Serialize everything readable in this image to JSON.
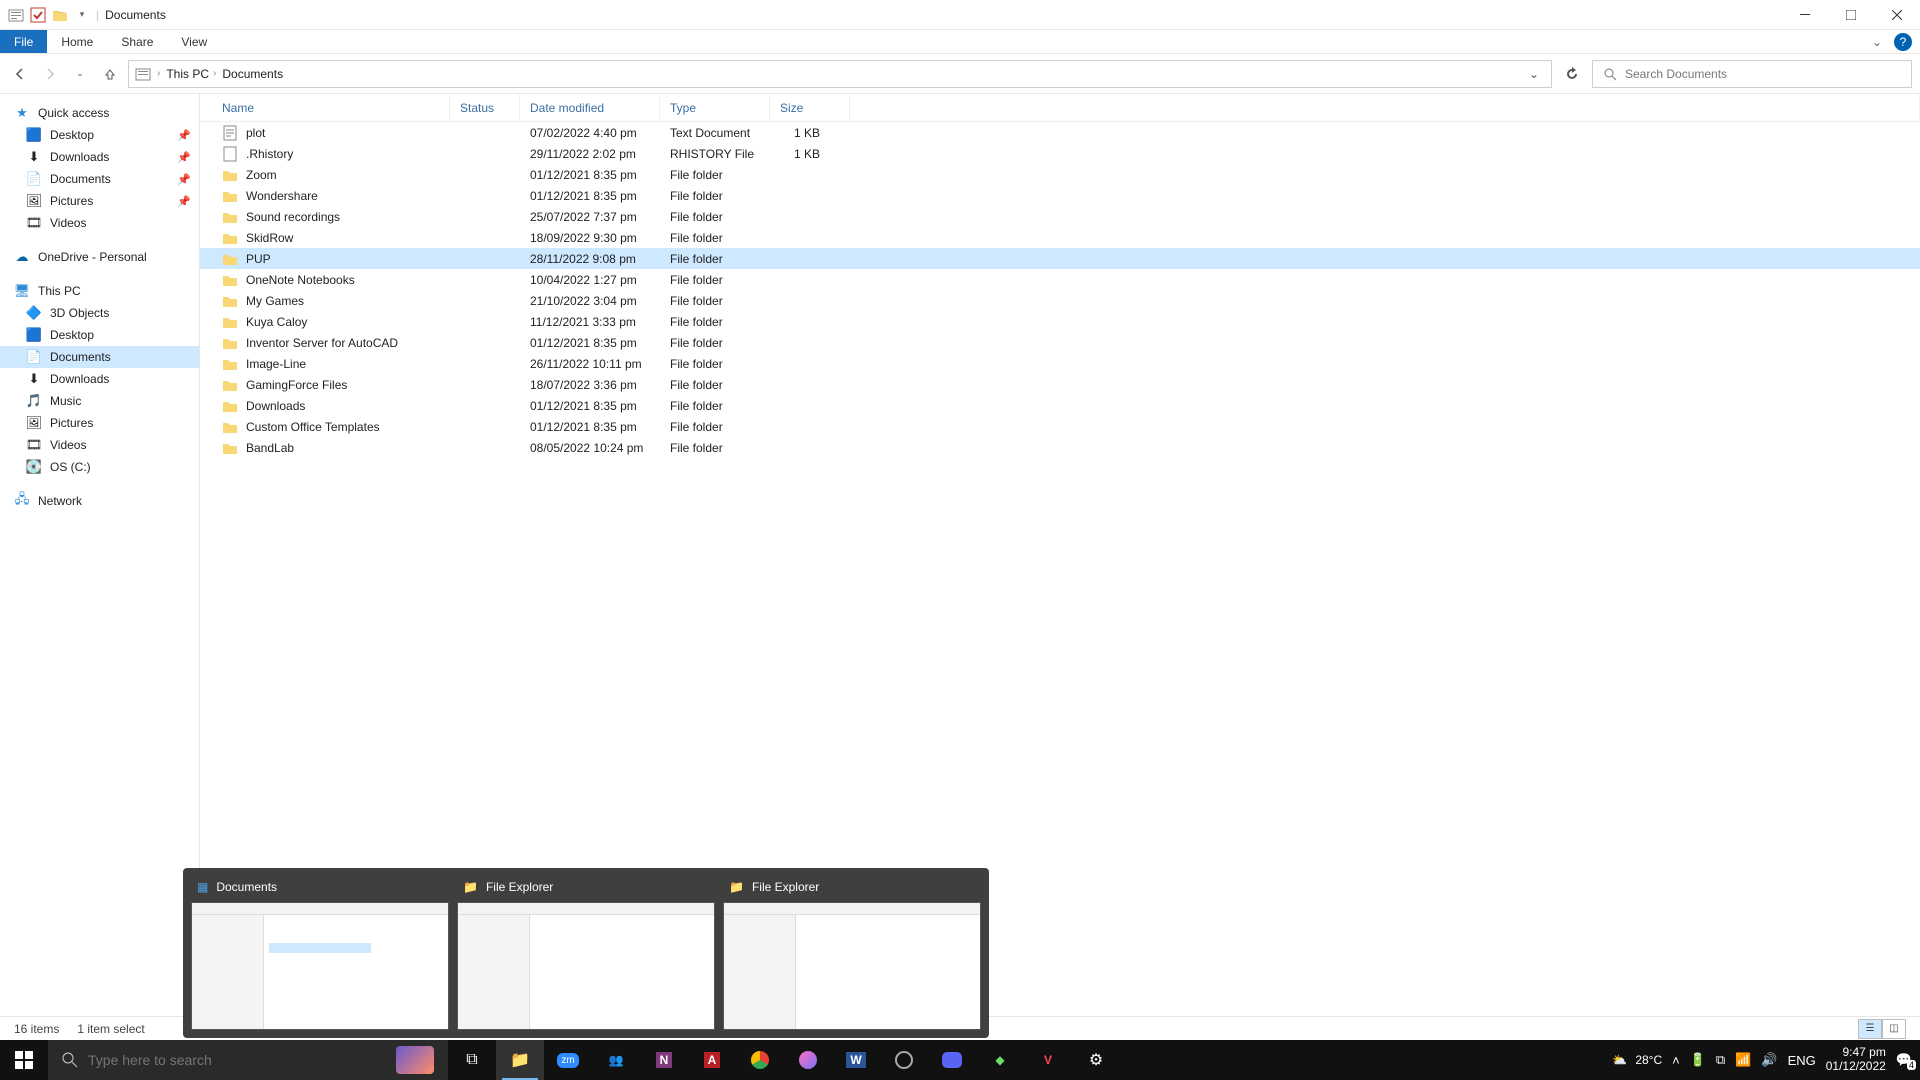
{
  "window": {
    "title": "Documents"
  },
  "ribbon": {
    "file": "File",
    "tabs": [
      "Home",
      "Share",
      "View"
    ]
  },
  "breadcrumb": {
    "root": "This PC",
    "current": "Documents"
  },
  "search": {
    "placeholder": "Search Documents"
  },
  "columns": {
    "name": "Name",
    "status": "Status",
    "date": "Date modified",
    "type": "Type",
    "size": "Size"
  },
  "sidebar": {
    "quick_access": "Quick access",
    "qa_items": [
      {
        "label": "Desktop",
        "pinned": true
      },
      {
        "label": "Downloads",
        "pinned": true
      },
      {
        "label": "Documents",
        "pinned": true
      },
      {
        "label": "Pictures",
        "pinned": true
      },
      {
        "label": "Videos",
        "pinned": false
      }
    ],
    "onedrive": "OneDrive - Personal",
    "this_pc": "This PC",
    "pc_items": [
      "3D Objects",
      "Desktop",
      "Documents",
      "Downloads",
      "Music",
      "Pictures",
      "Videos",
      "OS (C:)"
    ],
    "network": "Network"
  },
  "rows": [
    {
      "name": "plot",
      "date": "07/02/2022 4:40 pm",
      "type": "Text Document",
      "size": "1 KB",
      "icon": "text"
    },
    {
      "name": ".Rhistory",
      "date": "29/11/2022 2:02 pm",
      "type": "RHISTORY File",
      "size": "1 KB",
      "icon": "file"
    },
    {
      "name": "Zoom",
      "date": "01/12/2021 8:35 pm",
      "type": "File folder",
      "size": "",
      "icon": "folder"
    },
    {
      "name": "Wondershare",
      "date": "01/12/2021 8:35 pm",
      "type": "File folder",
      "size": "",
      "icon": "folder"
    },
    {
      "name": "Sound recordings",
      "date": "25/07/2022 7:37 pm",
      "type": "File folder",
      "size": "",
      "icon": "folder"
    },
    {
      "name": "SkidRow",
      "date": "18/09/2022 9:30 pm",
      "type": "File folder",
      "size": "",
      "icon": "folder"
    },
    {
      "name": "PUP",
      "date": "28/11/2022 9:08 pm",
      "type": "File folder",
      "size": "",
      "icon": "folder",
      "selected": true
    },
    {
      "name": "OneNote Notebooks",
      "date": "10/04/2022 1:27 pm",
      "type": "File folder",
      "size": "",
      "icon": "folder"
    },
    {
      "name": "My Games",
      "date": "21/10/2022 3:04 pm",
      "type": "File folder",
      "size": "",
      "icon": "folder"
    },
    {
      "name": "Kuya Caloy",
      "date": "11/12/2021 3:33 pm",
      "type": "File folder",
      "size": "",
      "icon": "folder"
    },
    {
      "name": "Inventor Server for AutoCAD",
      "date": "01/12/2021 8:35 pm",
      "type": "File folder",
      "size": "",
      "icon": "folder"
    },
    {
      "name": "Image-Line",
      "date": "26/11/2022 10:11 pm",
      "type": "File folder",
      "size": "",
      "icon": "folder"
    },
    {
      "name": "GamingForce Files",
      "date": "18/07/2022 3:36 pm",
      "type": "File folder",
      "size": "",
      "icon": "folder"
    },
    {
      "name": "Downloads",
      "date": "01/12/2021 8:35 pm",
      "type": "File folder",
      "size": "",
      "icon": "folder"
    },
    {
      "name": "Custom Office Templates",
      "date": "01/12/2021 8:35 pm",
      "type": "File folder",
      "size": "",
      "icon": "folder"
    },
    {
      "name": "BandLab",
      "date": "08/05/2022 10:24 pm",
      "type": "File folder",
      "size": "",
      "icon": "folder"
    }
  ],
  "status": {
    "count": "16 items",
    "selection": "1 item select"
  },
  "previews": [
    {
      "title": "Documents"
    },
    {
      "title": "File Explorer"
    },
    {
      "title": "File Explorer"
    }
  ],
  "taskbar": {
    "search_placeholder": "Type here to search",
    "weather": "28°C",
    "lang": "ENG",
    "time": "9:47 pm",
    "date": "01/12/2022",
    "notif": "4"
  }
}
